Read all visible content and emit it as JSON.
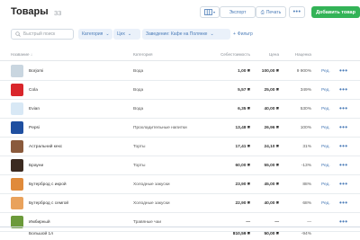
{
  "header": {
    "title": "Товары",
    "count": "33",
    "export_label": "Экспорт",
    "print_label": "Печать",
    "more_label": "•••",
    "add_label": "Добавить товар"
  },
  "filters": {
    "search_placeholder": "Быстрый поиск",
    "category_label": "Категория",
    "price_label": "Цех",
    "venue_label": "Заведение: Кафе на Полянке",
    "add_filter_label": "Фильтр"
  },
  "table": {
    "columns": {
      "name": "Название",
      "category": "Категория",
      "cost": "Себестоимость",
      "price": "Цена",
      "markup": "Наценка"
    },
    "rows": [
      {
        "name": "Borjomi",
        "category": "Вода",
        "cost": "1,00 ₴",
        "price": "100,00 ₴",
        "markup": "9 900%",
        "edit": "Ред.",
        "color": "#c9d6e0"
      },
      {
        "name": "Cola",
        "category": "Вода",
        "cost": "5,57 ₴",
        "price": "25,00 ₴",
        "markup": "349%",
        "edit": "Ред.",
        "color": "#d9262b"
      },
      {
        "name": "Evian",
        "category": "Вода",
        "cost": "6,35 ₴",
        "price": "40,00 ₴",
        "markup": "530%",
        "edit": "Ред.",
        "color": "#d8e8f5"
      },
      {
        "name": "Pepsi",
        "category": "Прохладительные напитки",
        "cost": "13,48 ₴",
        "price": "26,96 ₴",
        "markup": "100%",
        "edit": "Ред.",
        "color": "#1f4fa0"
      },
      {
        "name": "Астральний кекс",
        "category": "Торты",
        "cost": "17,41 ₴",
        "price": "24,10 ₴",
        "markup": "31%",
        "edit": "Ред.",
        "color": "#8a5a3c"
      },
      {
        "name": "Брауни",
        "category": "Торты",
        "cost": "60,00 ₴",
        "price": "55,00 ₴",
        "markup": "-13%",
        "edit": "Ред.",
        "color": "#3b2a20"
      },
      {
        "name": "Бутерброд с икрой",
        "category": "Холодные закуски",
        "cost": "23,90 ₴",
        "price": "45,00 ₴",
        "markup": "88%",
        "edit": "Ред.",
        "color": "#e08a3a"
      },
      {
        "name": "Бутерброд с семгой",
        "category": "Холодные закуски",
        "cost": "22,90 ₴",
        "price": "40,00 ₴",
        "markup": "68%",
        "edit": "Ред.",
        "color": "#e9a25c"
      },
      {
        "name": "Имбирный",
        "category": "Травяные чаи",
        "cost": "—",
        "price": "—",
        "markup": "—",
        "edit": "",
        "color": "#6b9a3a"
      }
    ],
    "total": {
      "label": "Большой 1л",
      "cost": "810,59 ₴",
      "price": "50,00 ₴",
      "markup": "-94%"
    }
  }
}
